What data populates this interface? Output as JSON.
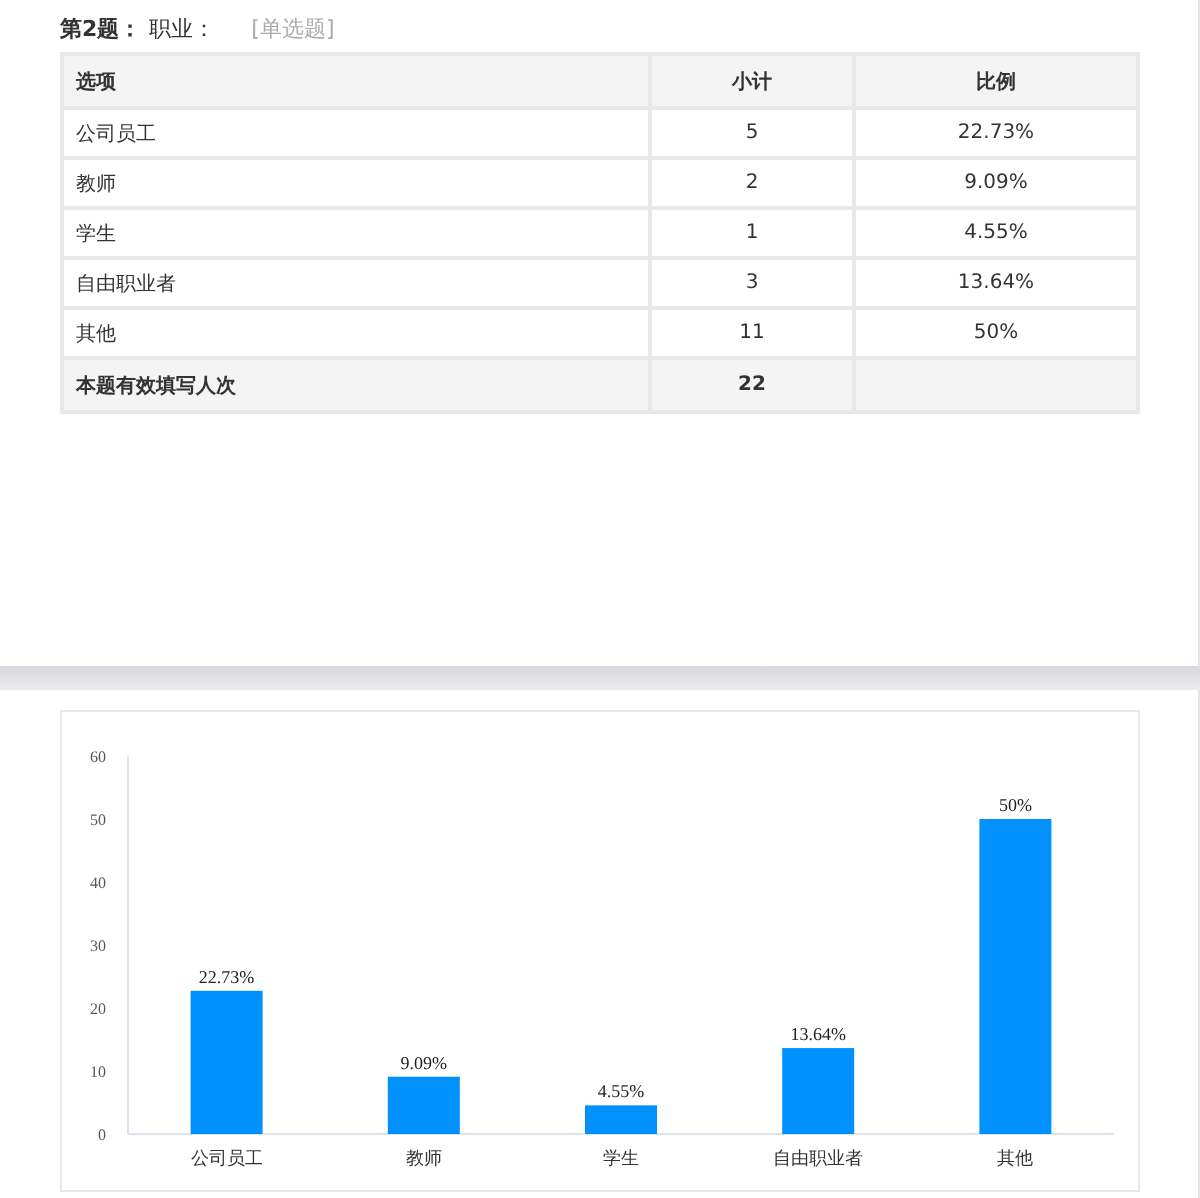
{
  "question": {
    "number": "第2题：",
    "title": "职业：",
    "type": "[单选题]"
  },
  "table": {
    "columns": [
      "选项",
      "小计",
      "比例"
    ],
    "rows": [
      {
        "option": "公司员工",
        "count": "5",
        "ratio": "22.73%"
      },
      {
        "option": "教师",
        "count": "2",
        "ratio": "9.09%"
      },
      {
        "option": "学生",
        "count": "1",
        "ratio": "4.55%"
      },
      {
        "option": "自由职业者",
        "count": "3",
        "ratio": "13.64%"
      },
      {
        "option": "其他",
        "count": "11",
        "ratio": "50%"
      }
    ],
    "total": {
      "label": "本题有效填写人次",
      "count": "22"
    }
  },
  "chart": {
    "chart_data": {
      "type": "bar",
      "categories": [
        "公司员工",
        "教师",
        "学生",
        "自由职业者",
        "其他"
      ],
      "values": [
        22.73,
        9.09,
        4.55,
        13.64,
        50
      ],
      "ylim": [
        0,
        60
      ],
      "yticks": [
        0,
        10,
        20,
        30,
        40,
        50,
        60
      ],
      "value_labels": [
        "22.73%",
        "9.09%",
        "4.55%",
        "13.64%",
        "50%"
      ]
    }
  }
}
